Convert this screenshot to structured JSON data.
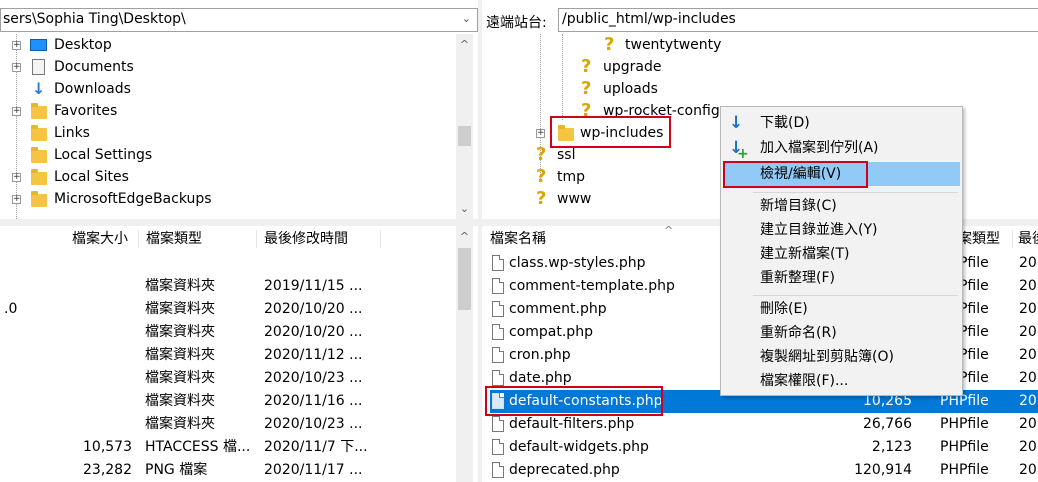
{
  "local": {
    "path": "sers\\Sophia Ting\\Desktop\\",
    "tree": [
      {
        "label": "Desktop",
        "icon": "desktop-icon",
        "expandable": true
      },
      {
        "label": "Documents",
        "icon": "document-icon",
        "expandable": true
      },
      {
        "label": "Downloads",
        "icon": "download-icon",
        "expandable": false
      },
      {
        "label": "Favorites",
        "icon": "favorites-folder-icon",
        "expandable": true
      },
      {
        "label": "Links",
        "icon": "link-folder-icon",
        "expandable": false
      },
      {
        "label": "Local Settings",
        "icon": "folder-icon",
        "expandable": false
      },
      {
        "label": "Local Sites",
        "icon": "folder-icon",
        "expandable": true
      },
      {
        "label": "MicrosoftEdgeBackups",
        "icon": "folder-icon",
        "expandable": true
      }
    ],
    "columns": [
      "檔案大小",
      "檔案類型",
      "最後修改時間"
    ],
    "rows": [
      {
        "name": "",
        "size": "",
        "type": "",
        "modified": ""
      },
      {
        "name": "",
        "size": "",
        "type": "檔案資料夾",
        "modified": "2019/11/15 ..."
      },
      {
        "name": ".0",
        "size": "",
        "type": "檔案資料夾",
        "modified": "2020/10/20 ..."
      },
      {
        "name": "",
        "size": "",
        "type": "檔案資料夾",
        "modified": "2020/10/20 ..."
      },
      {
        "name": "",
        "size": "",
        "type": "檔案資料夾",
        "modified": "2020/11/12 ..."
      },
      {
        "name": "",
        "size": "",
        "type": "檔案資料夾",
        "modified": "2020/10/23 ..."
      },
      {
        "name": "",
        "size": "",
        "type": "檔案資料夾",
        "modified": "2020/11/16 ..."
      },
      {
        "name": "",
        "size": "",
        "type": "檔案資料夾",
        "modified": "2020/10/23 ..."
      },
      {
        "name": "",
        "size": "10,573",
        "type": "HTACCESS 檔...",
        "modified": "2020/11/7 下..."
      },
      {
        "name": "",
        "size": "23,282",
        "type": "PNG 檔案",
        "modified": "2020/11/17 ..."
      }
    ]
  },
  "remote": {
    "path_label": "遠端站台:",
    "path": "/public_html/wp-includes",
    "tree": [
      {
        "label": "twentytwenty",
        "icon": "unknown-folder-icon"
      },
      {
        "label": "upgrade",
        "icon": "unknown-folder-icon"
      },
      {
        "label": "uploads",
        "icon": "unknown-folder-icon"
      },
      {
        "label": "wp-rocket-config",
        "icon": "unknown-folder-icon"
      },
      {
        "label": "wp-includes",
        "icon": "folder-icon"
      },
      {
        "label": "ssl",
        "icon": "unknown-folder-icon"
      },
      {
        "label": "tmp",
        "icon": "unknown-folder-icon"
      },
      {
        "label": "www",
        "icon": "unknown-folder-icon"
      }
    ],
    "columns": {
      "name": "檔案名稱",
      "type": "案類型",
      "modified": "最後"
    },
    "files": [
      {
        "name": "class.wp-styles.php",
        "size": "",
        "type": "PHPfile",
        "modified": "20"
      },
      {
        "name": "comment-template.php",
        "size": "",
        "type": "PHPfile",
        "modified": "20"
      },
      {
        "name": "comment.php",
        "size": "",
        "type": "PHPfile",
        "modified": "20"
      },
      {
        "name": "compat.php",
        "size": "",
        "type": "PHPfile",
        "modified": "20"
      },
      {
        "name": "cron.php",
        "size": "",
        "type": "PHPfile",
        "modified": "20"
      },
      {
        "name": "date.php",
        "size": "",
        "type": "PHPfile",
        "modified": "20"
      },
      {
        "name": "default-constants.php",
        "size": "10,265",
        "type": "PHPfile",
        "modified": "20"
      },
      {
        "name": "default-filters.php",
        "size": "26,766",
        "type": "PHPfile",
        "modified": "20"
      },
      {
        "name": "default-widgets.php",
        "size": "2,123",
        "type": "PHPfile",
        "modified": "20"
      },
      {
        "name": "deprecated.php",
        "size": "120,914",
        "type": "PHPfile",
        "modified": "20"
      }
    ],
    "selected_file": "default-constants.php"
  },
  "context_menu": {
    "items": [
      {
        "label": "下載(D)",
        "icon": "download-arrow-icon"
      },
      {
        "label": "加入檔案到佇列(A)",
        "icon": "add-to-queue-icon"
      },
      {
        "label": "檢視/編輯(V)",
        "icon": ""
      },
      {
        "label": "新增目錄(C)",
        "icon": ""
      },
      {
        "label": "建立目錄並進入(Y)",
        "icon": ""
      },
      {
        "label": "建立新檔案(T)",
        "icon": ""
      },
      {
        "label": "重新整理(F)",
        "icon": ""
      },
      {
        "label": "刪除(E)",
        "icon": ""
      },
      {
        "label": "重新命名(R)",
        "icon": ""
      },
      {
        "label": "複製網址到剪貼簿(O)",
        "icon": ""
      },
      {
        "label": "檔案權限(F)...",
        "icon": ""
      }
    ],
    "highlighted": "檢視/編輯(V)"
  },
  "colors": {
    "selection": "#0078d7",
    "menu_highlight": "#91c9f7",
    "annotation_box": "#d0021b"
  }
}
